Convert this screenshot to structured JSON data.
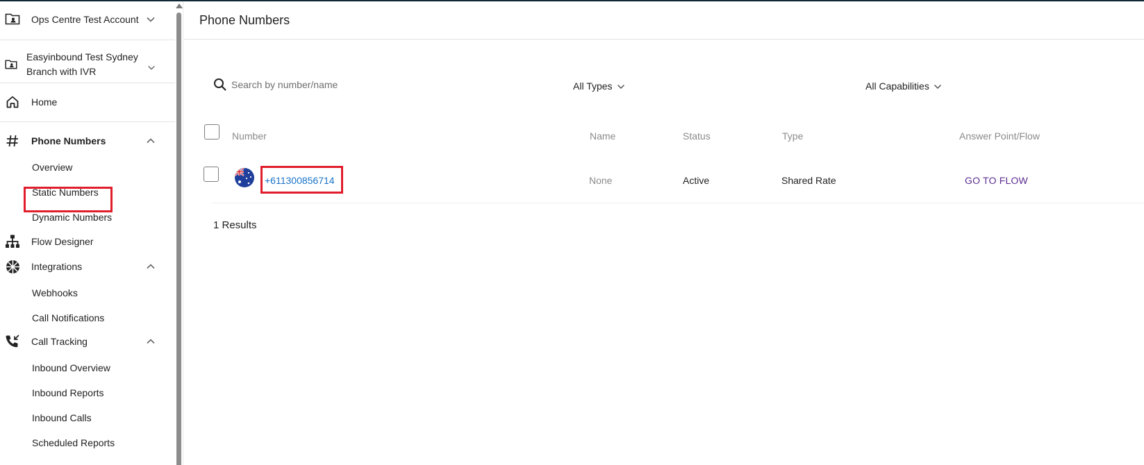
{
  "account": {
    "name": "Ops Centre Test Account",
    "branch_line1": "Easyinbound Test Sydney",
    "branch_line2": "Branch with IVR"
  },
  "sidebar": {
    "home": "Home",
    "phone_numbers": "Phone Numbers",
    "overview": "Overview",
    "static_numbers": "Static Numbers",
    "dynamic_numbers": "Dynamic Numbers",
    "flow_designer": "Flow Designer",
    "integrations": "Integrations",
    "webhooks": "Webhooks",
    "call_notifications": "Call Notifications",
    "call_tracking": "Call Tracking",
    "inbound_overview": "Inbound Overview",
    "inbound_reports": "Inbound Reports",
    "inbound_calls": "Inbound Calls",
    "scheduled_reports": "Scheduled Reports"
  },
  "page": {
    "title": "Phone Numbers"
  },
  "filters": {
    "search_placeholder": "Search by number/name",
    "types": "All Types",
    "capabilities": "All Capabilities"
  },
  "table": {
    "headers": {
      "number": "Number",
      "name": "Name",
      "status": "Status",
      "type": "Type",
      "answer_point": "Answer Point/Flow"
    },
    "rows": [
      {
        "number": "+611300856714",
        "name": "None",
        "status": "Active",
        "type": "Shared Rate",
        "action": "GO TO FLOW"
      }
    ]
  },
  "results_label": "1 Results",
  "colors": {
    "link": "#1a73c8",
    "flow_link": "#5b2d91",
    "highlight": "#e11d2b",
    "topbar": "#0f2a36"
  }
}
